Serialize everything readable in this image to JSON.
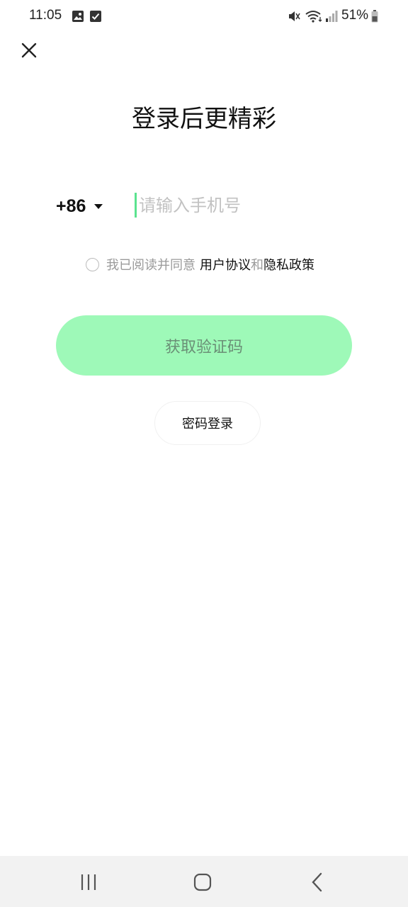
{
  "status_bar": {
    "time": "11:05",
    "battery": "51%"
  },
  "header": {
    "title": "登录后更精彩"
  },
  "login": {
    "country_code": "+86",
    "phone_placeholder": "请输入手机号",
    "phone_value": "",
    "agreement_prefix": "我已阅读并同意",
    "user_agreement": "用户协议",
    "agreement_and": "和",
    "privacy_policy": "隐私政策",
    "get_code_label": "获取验证码",
    "password_login_label": "密码登录"
  },
  "colors": {
    "accent": "#9ef9b8",
    "cursor": "#5be38f",
    "button_text": "#6a8f76"
  }
}
